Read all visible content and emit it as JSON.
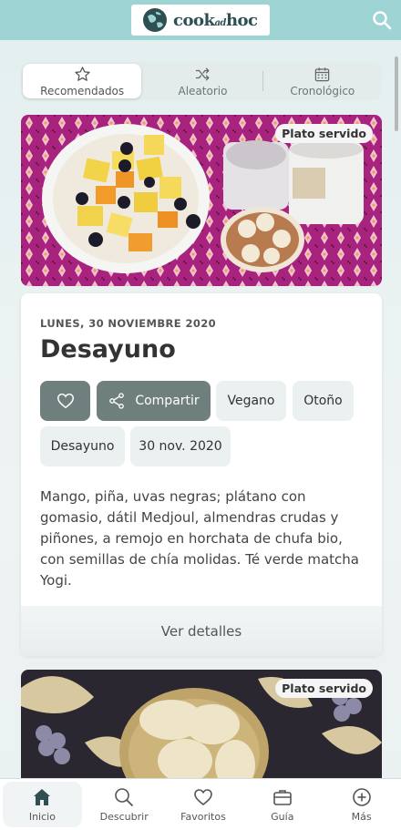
{
  "header": {
    "logo_text": "cook",
    "logo_small": "ad",
    "logo_text2": "hoc",
    "search_icon": "search-icon"
  },
  "tabs": [
    {
      "label": "Recomendados",
      "icon": "star-icon",
      "active": true
    },
    {
      "label": "Aleatorio",
      "icon": "shuffle-icon",
      "active": false
    },
    {
      "label": "Cronológico",
      "icon": "calendar-icon",
      "active": false
    }
  ],
  "post": {
    "badge": "Plato servido",
    "date": "LUNES, 30 NOVIEMBRE 2020",
    "title": "Desayuno",
    "share_label": "Compartir",
    "tags": [
      "Vegano",
      "Otoño",
      "Desayuno",
      "30 nov. 2020"
    ],
    "description": "Mango, piña, uvas negras; plátano con gomasio, dátil Medjoul, almendras crudas y piñones, a remojo en horchata de chufa bio, con semillas de chía molidas. Té verde matcha Yogi.",
    "details_label": "Ver detalles"
  },
  "post2": {
    "badge": "Plato servido"
  },
  "bottom_nav": [
    {
      "label": "Inicio",
      "icon": "home-icon",
      "active": true
    },
    {
      "label": "Descubrir",
      "icon": "search-icon",
      "active": false
    },
    {
      "label": "Favoritos",
      "icon": "heart-icon",
      "active": false
    },
    {
      "label": "Guía",
      "icon": "briefcase-icon",
      "active": false
    },
    {
      "label": "Más",
      "icon": "plus-circle-icon",
      "active": false
    }
  ],
  "colors": {
    "header": "#9fd4d5",
    "accent": "#6f7f7d",
    "chip": "#ebf0f0"
  }
}
